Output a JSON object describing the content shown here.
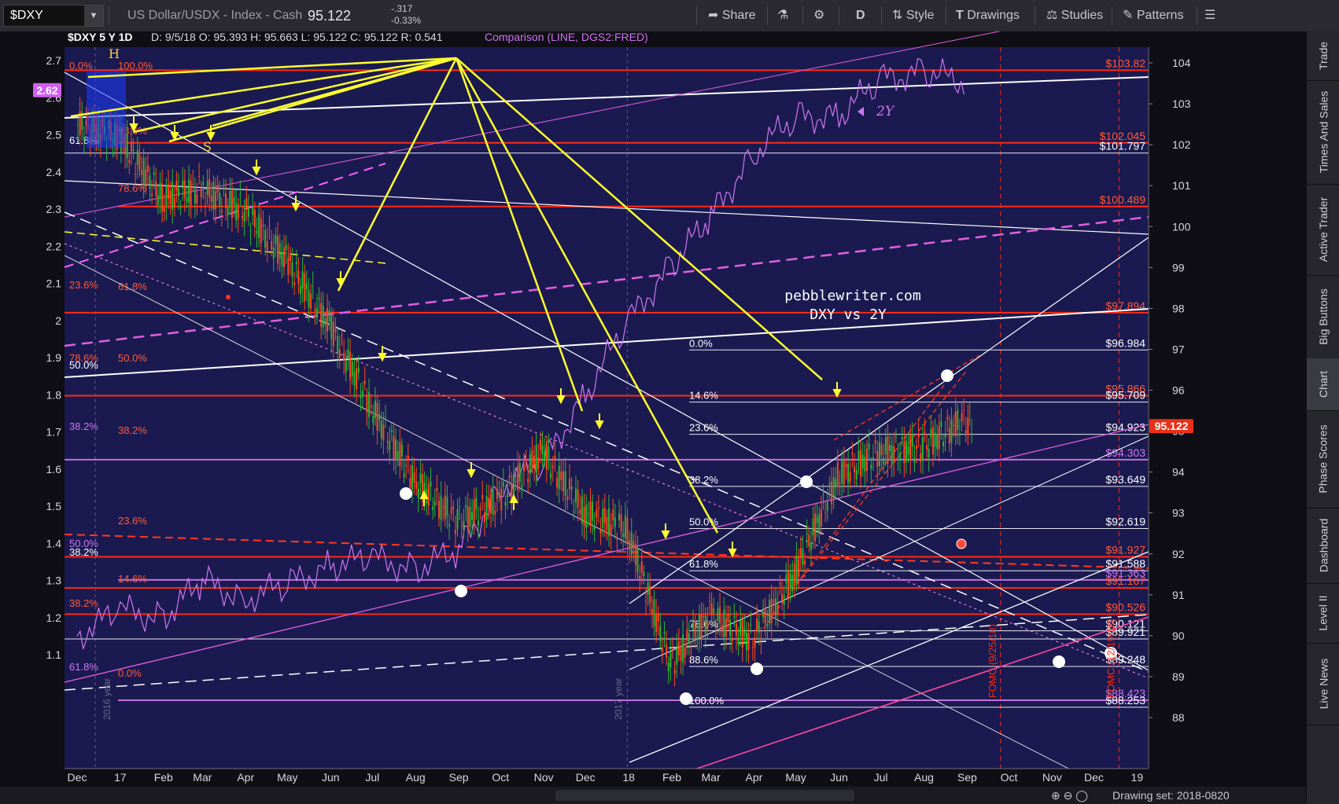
{
  "toolbar": {
    "symbol": "$DXY",
    "description": "US Dollar/USDX - Index - Cash",
    "last": "95.122",
    "change": "-.317",
    "change_pct": "-0.33%",
    "share": "Share",
    "period": "D",
    "style": "Style",
    "drawings": "Drawings",
    "studies": "Studies",
    "patterns": "Patterns"
  },
  "header": {
    "symbol": "$DXY 5 Y 1D",
    "ohlc": "D: 9/5/18  O: 95.393  H: 95.663  L: 95.122  C: 95.122  R: 0.541",
    "comparison": "Comparison (LINE, DGS2:FRED)"
  },
  "sidebar": {
    "tabs": [
      "Trade",
      "Times And Sales",
      "Active Trader",
      "Big Buttons",
      "Chart",
      "Phase Scores",
      "Dashboard",
      "Level II",
      "Live News"
    ]
  },
  "footer": {
    "drawing_set": "Drawing set: 2018-0820"
  },
  "colors": {
    "background": "#1b1a50",
    "candle_up": "#2fb52f",
    "candle_down": "#ff4a1a",
    "comparison": "#cc77ee",
    "fib_lines": "#ff2a10",
    "arrows": "#ffff30",
    "price_box": "#e8301a"
  },
  "chart_data": {
    "type": "line",
    "title": "pebblewriter.com DXY vs 2Y",
    "xlabel": "",
    "ylabel": "",
    "x_ticks": [
      "Dec",
      "17",
      "Feb",
      "Mar",
      "Apr",
      "May",
      "Jun",
      "Jul",
      "Aug",
      "Sep",
      "Oct",
      "Nov",
      "Dec",
      "18",
      "Feb",
      "Mar",
      "Apr",
      "May",
      "Jun",
      "Jul",
      "Aug",
      "Sep",
      "Oct",
      "Nov",
      "Dec",
      "19"
    ],
    "ylim_left": [
      1.0,
      2.75
    ],
    "ylim_right": [
      87.6,
      104.4
    ],
    "left_ticks": [
      "2.7",
      "2.6",
      "2.5",
      "2.4",
      "2.3",
      "2.2",
      "2.1",
      "2",
      "1.9",
      "1.8",
      "1.7",
      "1.6",
      "1.5",
      "1.4",
      "1.3",
      "1.2",
      "1.1"
    ],
    "right_ticks": [
      "104",
      "103",
      "102",
      "101",
      "100",
      "99",
      "98",
      "97",
      "96",
      "95",
      "94",
      "93",
      "92",
      "91",
      "90",
      "89",
      "88"
    ],
    "current_left": "2.62",
    "current_price": "95.122",
    "series": [
      {
        "name": "$DXY",
        "type": "candles",
        "x": [
          "2016-12",
          "2017-01",
          "2017-02",
          "2017-03",
          "2017-04",
          "2017-05",
          "2017-06",
          "2017-07",
          "2017-08",
          "2017-09",
          "2017-10",
          "2017-11",
          "2017-12",
          "2018-01",
          "2018-02",
          "2018-03",
          "2018-04",
          "2018-05",
          "2018-06",
          "2018-07",
          "2018-08",
          "2018-09"
        ],
        "values": [
          102.2,
          100.7,
          100.9,
          100.4,
          99.2,
          97.6,
          95.6,
          93.8,
          92.8,
          93.3,
          94.5,
          93.0,
          92.6,
          89.3,
          90.5,
          89.9,
          91.5,
          93.9,
          94.5,
          94.6,
          95.3,
          95.1
        ]
      },
      {
        "name": "DGS2",
        "type": "line",
        "x": [
          "2016-12",
          "2017-01",
          "2017-02",
          "2017-03",
          "2017-04",
          "2017-05",
          "2017-06",
          "2017-07",
          "2017-08",
          "2017-09",
          "2017-10",
          "2017-11",
          "2017-12",
          "2018-01",
          "2018-02",
          "2018-03",
          "2018-04",
          "2018-05",
          "2018-06",
          "2018-07",
          "2018-08",
          "2018-09"
        ],
        "values": [
          1.15,
          1.22,
          1.2,
          1.3,
          1.25,
          1.29,
          1.34,
          1.36,
          1.33,
          1.38,
          1.55,
          1.62,
          1.8,
          2.0,
          2.15,
          2.28,
          2.45,
          2.55,
          2.55,
          2.65,
          2.67,
          2.64
        ]
      }
    ],
    "fib_levels_left": [
      {
        "pct": "0.0%",
        "value": 103.82
      },
      {
        "pct": "100.0%",
        "value": 103.82
      },
      {
        "pct": "88.6%",
        "value": 102.045
      },
      {
        "pct": "61.8%",
        "value": 101.797
      },
      {
        "pct": "78.6%",
        "value": 100.489
      },
      {
        "pct": "23.6%",
        "value": 97.894
      },
      {
        "pct": "61.8%",
        "value": 97.894
      },
      {
        "pct": "78.6%",
        "value": 95.866
      },
      {
        "pct": "50.0%",
        "value": 95.866
      },
      {
        "pct": "50.0%",
        "value": 95.709
      },
      {
        "pct": "38.2%",
        "value": 94.303
      },
      {
        "pct": "38.2%",
        "value": 94.303
      },
      {
        "pct": "23.6%",
        "value": 91.927
      },
      {
        "pct": "50.0%",
        "value": 91.363
      },
      {
        "pct": "38.2%",
        "value": 91.167
      },
      {
        "pct": "14.6%",
        "value": 90.526
      },
      {
        "pct": "38.2%",
        "value": 89.921
      },
      {
        "pct": "61.8%",
        "value": 88.423
      },
      {
        "pct": "0.0%",
        "value": 88.253
      }
    ],
    "fib_levels_right": [
      {
        "pct": "0.0%",
        "value": 96.984
      },
      {
        "pct": "14.6%",
        "value": 95.709
      },
      {
        "pct": "23.6%",
        "value": 94.923
      },
      {
        "pct": "38.2%",
        "value": 93.649
      },
      {
        "pct": "50.0%",
        "value": 92.619
      },
      {
        "pct": "61.8%",
        "value": 91.588
      },
      {
        "pct": "78.6%",
        "value": 90.121
      },
      {
        "pct": "88.6%",
        "value": 89.248
      },
      {
        "pct": "100.0%",
        "value": 88.253
      }
    ],
    "price_labels": [
      {
        "text": "$103.82",
        "value": 103.82,
        "color": "#ff5a3a"
      },
      {
        "text": "$102.045",
        "value": 102.045,
        "color": "#ff5a3a"
      },
      {
        "text": "$101.797",
        "value": 101.797,
        "color": "#ffffff"
      },
      {
        "text": "$100.489",
        "value": 100.489,
        "color": "#ff5a3a"
      },
      {
        "text": "$97.894",
        "value": 97.894,
        "color": "#ff5a3a"
      },
      {
        "text": "$96.984",
        "value": 96.984,
        "color": "#ffffff"
      },
      {
        "text": "$95.866",
        "value": 95.866,
        "color": "#ff5a3a"
      },
      {
        "text": "$95.709",
        "value": 95.709,
        "color": "#ffffff"
      },
      {
        "text": "$94.923",
        "value": 94.923,
        "color": "#ffffff"
      },
      {
        "text": "$94.303",
        "value": 94.303,
        "color": "#cc77ee"
      },
      {
        "text": "$93.649",
        "value": 93.649,
        "color": "#ffffff"
      },
      {
        "text": "$92.619",
        "value": 92.619,
        "color": "#ffffff"
      },
      {
        "text": "$91.927",
        "value": 91.927,
        "color": "#ff5a3a"
      },
      {
        "text": "$91.588",
        "value": 91.588,
        "color": "#ffffff"
      },
      {
        "text": "$91.363",
        "value": 91.363,
        "color": "#cc77ee"
      },
      {
        "text": "$91.167",
        "value": 91.167,
        "color": "#ff5a3a"
      },
      {
        "text": "$90.526",
        "value": 90.526,
        "color": "#ff5a3a"
      },
      {
        "text": "$90.121",
        "value": 90.121,
        "color": "#ffffff"
      },
      {
        "text": "$89.921",
        "value": 89.921,
        "color": "#ffffff"
      },
      {
        "text": "$89.248",
        "value": 89.248,
        "color": "#ffffff"
      },
      {
        "text": "$88.423",
        "value": 88.423,
        "color": "#cc77ee"
      },
      {
        "text": "$88.253",
        "value": 88.253,
        "color": "#ffffff"
      }
    ],
    "annotations": [
      "H",
      "S",
      "2Y",
      "2016 year",
      "2017 year",
      "FOMC (9/25/18)",
      "FOMC (12/19/18)"
    ],
    "grid": false,
    "legend": "none"
  }
}
